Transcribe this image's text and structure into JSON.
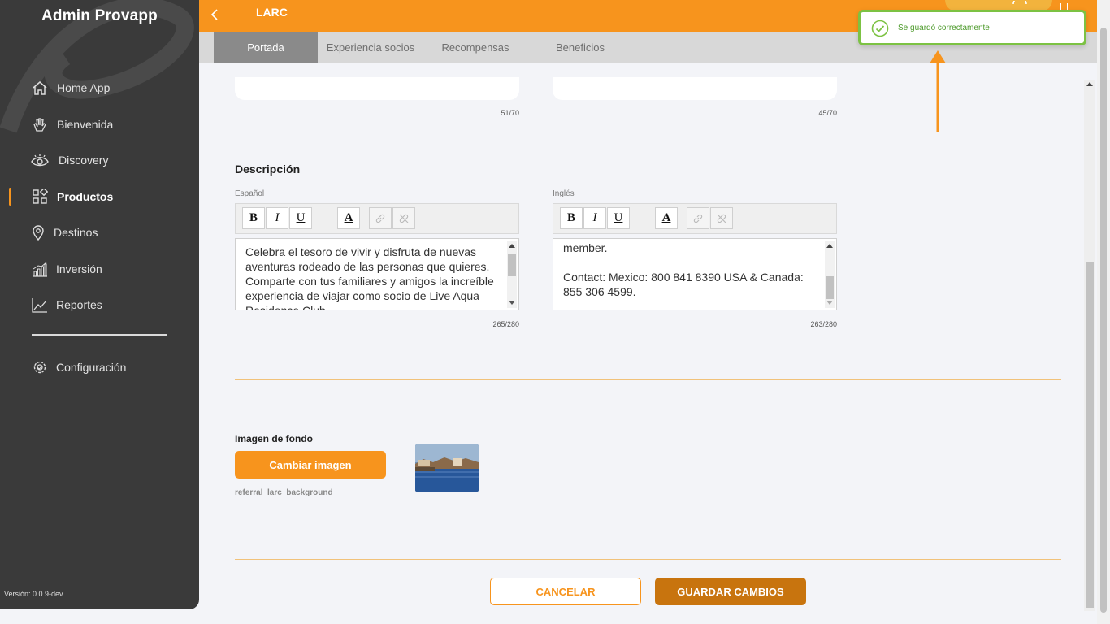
{
  "app": {
    "brand": "Admin Provapp",
    "version": "Versión: 0.0.9-dev"
  },
  "sidebar": {
    "items": [
      {
        "label": "Home App",
        "icon": "home-icon"
      },
      {
        "label": "Bienvenida",
        "icon": "wave-hand-icon"
      },
      {
        "label": "Discovery",
        "icon": "eye-icon"
      },
      {
        "label": "Productos",
        "icon": "products-grid-icon",
        "active": true
      },
      {
        "label": "Destinos",
        "icon": "map-pin-icon"
      },
      {
        "label": "Inversión",
        "icon": "bar-chart-icon"
      },
      {
        "label": "Reportes",
        "icon": "line-chart-icon"
      }
    ],
    "settings": {
      "label": "Configuración",
      "icon": "gear-icon"
    }
  },
  "header": {
    "title": "LARC",
    "back_icon": "chevron-left-icon"
  },
  "tabs": [
    {
      "label": "Portada",
      "active": true
    },
    {
      "label": "Experiencia socios"
    },
    {
      "label": "Recompensas"
    },
    {
      "label": "Beneficios"
    }
  ],
  "top_counters": {
    "es": "51/70",
    "en": "45/70"
  },
  "description": {
    "title": "Descripción",
    "es": {
      "label": "Español",
      "text": "Celebra el tesoro de vivir y disfruta de nuevas aventuras rodeado de las personas que quieres. Comparte con tus familiares y amigos la increíble experiencia de viajar como socio de Live Aqua Residence Club",
      "counter": "265/280"
    },
    "en": {
      "label": "Inglés",
      "text": "member.\n\nContact: Mexico: 800 841 8390 USA & Canada: 855 306 4599.",
      "counter": "263/280"
    },
    "toolbar": {
      "bold": "B",
      "italic": "I",
      "underline": "U",
      "color": "A"
    }
  },
  "background_image": {
    "title": "Imagen de fondo",
    "button": "Cambiar imagen",
    "filename": "referral_larc_background"
  },
  "actions": {
    "cancel": "CANCELAR",
    "save": "GUARDAR CAMBIOS"
  },
  "toast": {
    "message": "Se guardó correctamente",
    "color": "#7cc243"
  },
  "colors": {
    "accent": "#f7941d",
    "sidebar": "#3a3a3a",
    "save": "#c8740e"
  }
}
